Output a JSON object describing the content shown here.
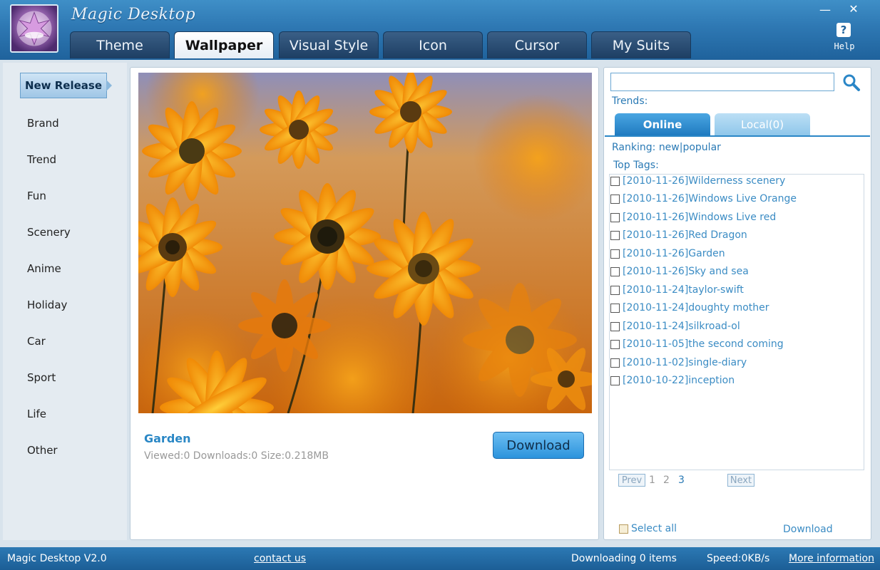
{
  "app": {
    "title": "Magic Desktop",
    "help_label": "Help",
    "help_glyph": "?",
    "minimize_glyph": "—",
    "close_glyph": "✕"
  },
  "tabs": [
    {
      "label": "Theme",
      "active": false
    },
    {
      "label": "Wallpaper",
      "active": true
    },
    {
      "label": "Visual Style",
      "active": false
    },
    {
      "label": "Icon",
      "active": false
    },
    {
      "label": "Cursor",
      "active": false
    },
    {
      "label": "My Suits",
      "active": false
    }
  ],
  "sidebar": {
    "items": [
      {
        "label": "New Release",
        "selected": true
      },
      {
        "label": "Brand"
      },
      {
        "label": "Trend"
      },
      {
        "label": "Fun"
      },
      {
        "label": "Scenery"
      },
      {
        "label": "Anime"
      },
      {
        "label": "Holiday"
      },
      {
        "label": "Car"
      },
      {
        "label": "Sport"
      },
      {
        "label": "Life"
      },
      {
        "label": "Other"
      }
    ]
  },
  "preview": {
    "title": "Garden",
    "stats": "Viewed:0 Downloads:0 Size:0.218MB",
    "download_label": "Download"
  },
  "right_panel": {
    "search_value": "",
    "trends_label": "Trends:",
    "tab_online": "Online",
    "tab_local": "Local(0)",
    "ranking_label": "Ranking:",
    "ranking_new": "new",
    "ranking_sep": "|",
    "ranking_popular": "popular",
    "top_tags_label": "Top Tags:",
    "tags": [
      "[2010-11-26]Wilderness scenery",
      "[2010-11-26]Windows Live Orange",
      "[2010-11-26]Windows Live red",
      "[2010-11-26]Red Dragon",
      "[2010-11-26]Garden",
      "[2010-11-26]Sky and sea",
      "[2010-11-24]taylor-swift",
      "[2010-11-24]doughty mother",
      "[2010-11-24]silkroad-ol",
      "[2010-11-05]the second coming",
      "[2010-11-02]single-diary",
      "[2010-10-22]inception"
    ],
    "pager": {
      "prev": "Prev",
      "pages": [
        "1",
        "2",
        "3"
      ],
      "next": "Next"
    },
    "select_all_label": "Select all",
    "download_link": "Download"
  },
  "status": {
    "version": "Magic Desktop V2.0",
    "contact": "contact us",
    "downloading": "Downloading 0 items",
    "speed": "Speed:0KB/s",
    "more_info": "More information"
  },
  "colors": {
    "accent": "#2a86c7",
    "title_bar": "#2e78b3",
    "link": "#3b8cc4",
    "status_bar": "#1c5e96"
  }
}
